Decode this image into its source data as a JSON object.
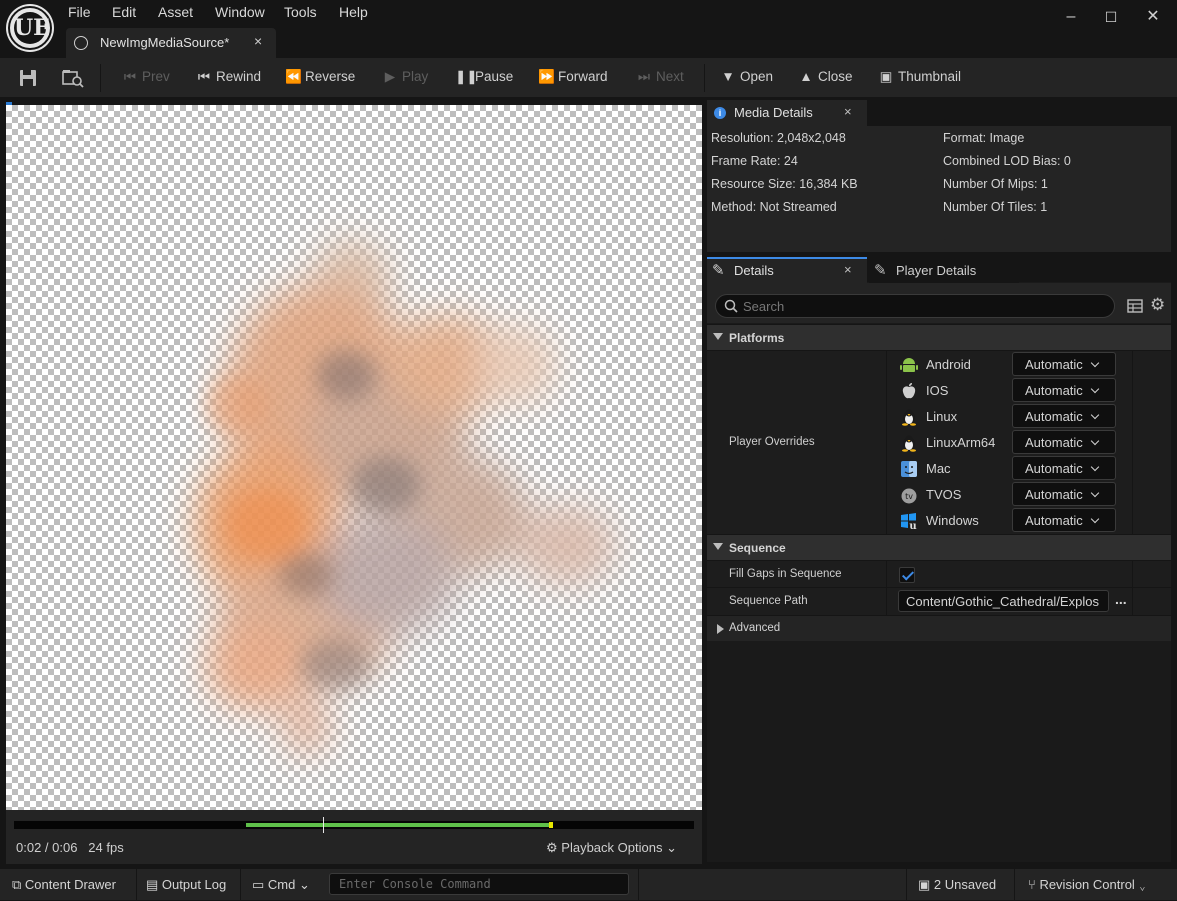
{
  "app": {
    "logo": "UE",
    "menus": [
      "File",
      "Edit",
      "Asset",
      "Window",
      "Tools",
      "Help"
    ],
    "tab_title": "NewImgMediaSource*",
    "tab_close": "×",
    "window_controls": [
      "–",
      "☐",
      "✕"
    ]
  },
  "toolbar": {
    "prev": "Prev",
    "rewind": "Rewind",
    "reverse": "Reverse",
    "play": "Play",
    "pause": "Pause",
    "forward": "Forward",
    "next": "Next",
    "open": "Open",
    "close": "Close",
    "thumbnail": "Thumbnail",
    "disabled": [
      "Prev",
      "Play",
      "Next"
    ]
  },
  "playback": {
    "time": "0:02 / 0:06   24 fps",
    "options_label": "Playback Options",
    "progress": 0.455,
    "buffered_start": 0.341,
    "buffered_end": 0.79
  },
  "media_details": {
    "tab_label": "Media Details",
    "close": "×",
    "left": [
      "Resolution: 2,048x2,048",
      "Frame Rate: 24",
      "Resource Size: 16,384 KB",
      "Method: Not Streamed"
    ],
    "right": [
      "Format: Image",
      "Combined LOD Bias: 0",
      "Number Of Mips: 1",
      "Number Of Tiles: 1"
    ]
  },
  "details": {
    "tab_label": "Details",
    "close": "×",
    "player_tab_label": "Player Details",
    "search_placeholder": "Search",
    "platforms_category": "Platforms",
    "player_overrides_label": "Player Overrides",
    "platforms": [
      {
        "name": "Android",
        "value": "Automatic",
        "icon": "android-icon"
      },
      {
        "name": "IOS",
        "value": "Automatic",
        "icon": "apple-icon"
      },
      {
        "name": "Linux",
        "value": "Automatic",
        "icon": "linux-icon"
      },
      {
        "name": "LinuxArm64",
        "value": "Automatic",
        "icon": "linux-icon"
      },
      {
        "name": "Mac",
        "value": "Automatic",
        "icon": "mac-icon"
      },
      {
        "name": "TVOS",
        "value": "Automatic",
        "icon": "tvos-icon"
      },
      {
        "name": "Windows",
        "value": "Automatic",
        "icon": "windows-icon"
      }
    ],
    "sequence_category": "Sequence",
    "fill_gaps_label": "Fill Gaps in Sequence",
    "fill_gaps_checked": true,
    "sequence_path_label": "Sequence Path",
    "sequence_path_value": "Content/Gothic_Cathedral/Explos",
    "browse": "...",
    "advanced_category": "Advanced"
  },
  "statusbar": {
    "content_drawer": "Content Drawer",
    "output_log": "Output Log",
    "cmd": "Cmd",
    "console_placeholder": "Enter Console Command",
    "unsaved": "2 Unsaved",
    "revision_control": "Revision Control"
  }
}
